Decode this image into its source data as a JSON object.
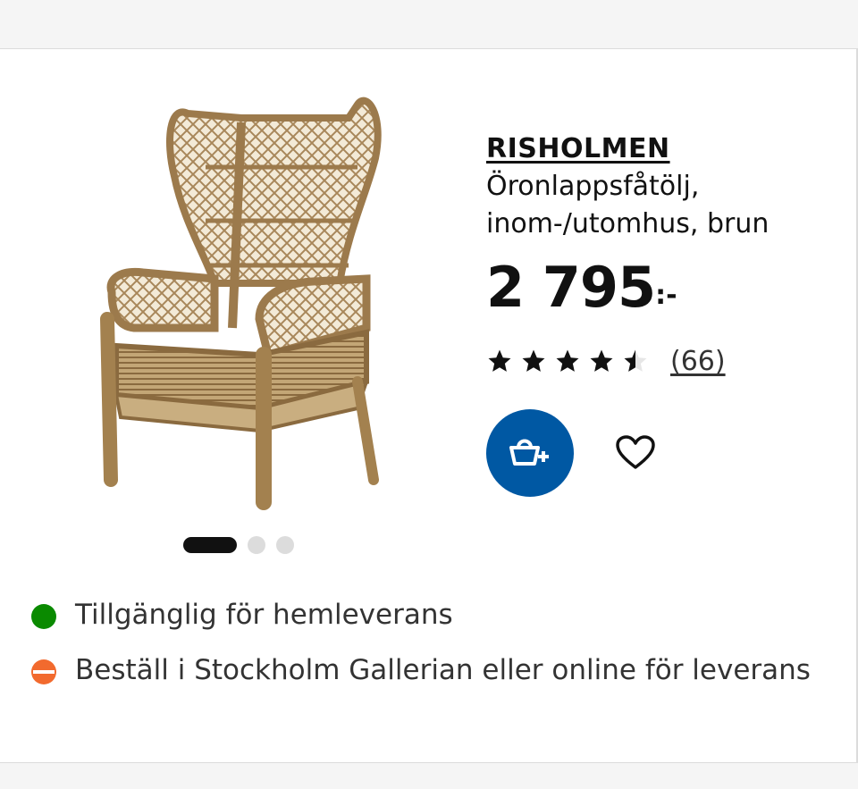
{
  "product": {
    "name": "RISHOLMEN",
    "description": "Öronlappsfåtölj, inom-/utomhus, brun",
    "price_main": "2 795",
    "price_suffix": ":-",
    "rating": 4.5,
    "rating_max": 5,
    "review_count": "(66)",
    "image_icon": "wicker-wing-chair-image"
  },
  "carousel": {
    "slide_count": 3,
    "active_index": 0
  },
  "actions": {
    "add_to_cart_icon": "basket-plus-icon",
    "favorite_icon": "heart-outline-icon"
  },
  "availability": [
    {
      "status": "available",
      "icon": "green-dot-icon",
      "text": "Tillgänglig för hemleverans"
    },
    {
      "status": "partial",
      "icon": "half-orange-dot-icon",
      "text": "Beställ i Stockholm Gallerian eller online för leverans"
    }
  ],
  "colors": {
    "brand_blue": "#0058a3",
    "available_green": "#0a8a00",
    "partial_orange": "#f26a2e",
    "text_dark": "#111111",
    "divider": "#dcdcdc"
  }
}
